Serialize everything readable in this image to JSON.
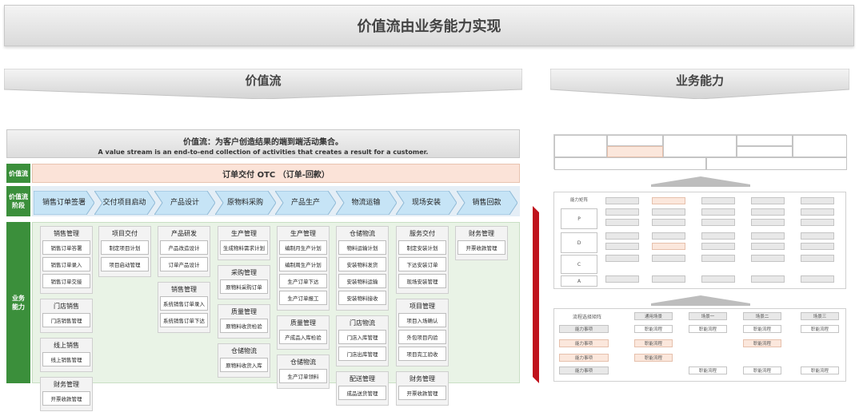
{
  "title": "价值流由业务能力实现",
  "left_header": "价值流",
  "right_header": "业务能力",
  "definition": {
    "zh": "价值流：为客户创造结果的端到端活动集合。",
    "en": "A value stream is an end-to-end collection of activities that creates a result for a customer."
  },
  "row_labels": {
    "value_stream": "价值流",
    "stage": "价值流阶段",
    "capability": "业务能力"
  },
  "otc_label": "订单交付 OTC （订单-回款）",
  "stages": [
    "销售订单签署",
    "交付项目启动",
    "产品设计",
    "原物料采购",
    "产品生产",
    "物流运输",
    "现场安装",
    "销售回款"
  ],
  "capabilities": [
    [
      {
        "title": "销售管理",
        "items": [
          "销售订单答署",
          "销售订单录入",
          "销售订单交接"
        ]
      },
      {
        "title": "门店销售",
        "items": [
          "门店销售管理"
        ]
      },
      {
        "title": "线上销售",
        "items": [
          "线上销售管理"
        ]
      },
      {
        "title": "财务管理",
        "items": [
          "开票收款管理"
        ]
      }
    ],
    [
      {
        "title": "项目交付",
        "items": [
          "制定项目计划",
          "项目启动管理"
        ]
      }
    ],
    [
      {
        "title": "产品研发",
        "items": [
          "产品改造设计",
          "订单产品设计"
        ]
      },
      {
        "title": "销售管理",
        "items": [
          "系统销售订单录入",
          "系统销售订单下达"
        ]
      }
    ],
    [
      {
        "title": "生产管理",
        "items": [
          "生成物料需求计划"
        ]
      },
      {
        "title": "采购管理",
        "items": [
          "原物料采购订单"
        ]
      },
      {
        "title": "质量管理",
        "items": [
          "原物料收货检验"
        ]
      },
      {
        "title": "仓储物流",
        "items": [
          "原物料收货入库"
        ]
      }
    ],
    [
      {
        "title": "生产管理",
        "items": [
          "编制月生产计划",
          "编制周生产计划",
          "生产订单下达",
          "生产订单报工"
        ]
      },
      {
        "title": "质量管理",
        "items": [
          "产成品入库检验"
        ]
      },
      {
        "title": "仓储物流",
        "items": [
          "生产订单领料"
        ]
      }
    ],
    [
      {
        "title": "仓储物流",
        "items": [
          "物料运输计划",
          "安装物料发货",
          "安装物料运输",
          "安装物料接收"
        ]
      },
      {
        "title": "门店物流",
        "items": [
          "门店入库管理",
          "门店出库管理"
        ]
      },
      {
        "title": "配送管理",
        "items": [
          "成品送货管理"
        ]
      }
    ],
    [
      {
        "title": "服务交付",
        "items": [
          "制定安装计划",
          "下达安装订单",
          "现场安装管理"
        ]
      },
      {
        "title": "项目管理",
        "items": [
          "项目入场确认",
          "外包项目内验",
          "项目完工验收"
        ]
      },
      {
        "title": "财务管理",
        "items": [
          "开票收款管理"
        ]
      }
    ],
    [
      {
        "title": "财务管理",
        "items": [
          "开票收款管理"
        ]
      }
    ]
  ],
  "matrix1": {
    "header": "能力矩阵",
    "rows": [
      "P",
      "D",
      "C",
      "A"
    ]
  },
  "matrix2": {
    "header": "流程选择矩阵",
    "columns": [
      "通用场景",
      "场景一",
      "场景二",
      "场景三"
    ],
    "row_labels": [
      "能力事项",
      "能力事项",
      "能力事项",
      "能力事项"
    ],
    "cell_label": "职能流程"
  },
  "colors": {
    "green": "#3b8f3b",
    "peach": "#fbe3d8",
    "arrow_blue": "#bfe0f5",
    "red_bar": "#c0121c"
  }
}
